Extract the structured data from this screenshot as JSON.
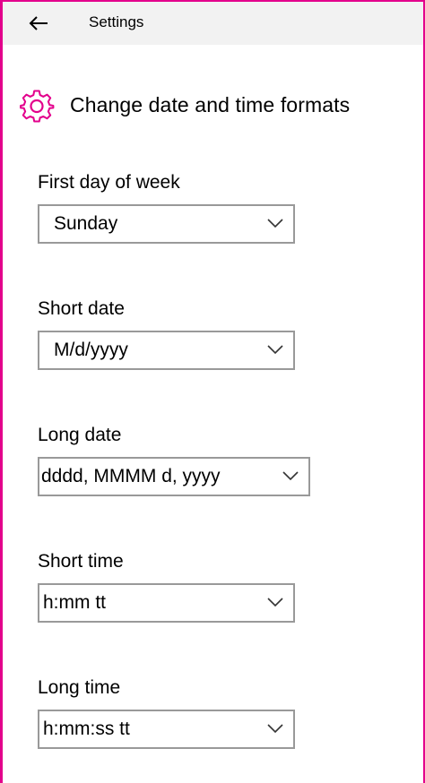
{
  "titlebar": {
    "back_icon": "arrow-left-icon",
    "title": "Settings"
  },
  "header": {
    "icon": "gear-icon",
    "accent_color": "#e3008c",
    "title": "Change date and time formats"
  },
  "fields": [
    {
      "label": "First day of week",
      "value": "Sunday"
    },
    {
      "label": "Short date",
      "value": "M/d/yyyy"
    },
    {
      "label": "Long date",
      "value": "dddd, MMMM d, yyyy"
    },
    {
      "label": "Short time",
      "value": "h:mm tt"
    },
    {
      "label": "Long time",
      "value": "h:mm:ss tt"
    }
  ]
}
